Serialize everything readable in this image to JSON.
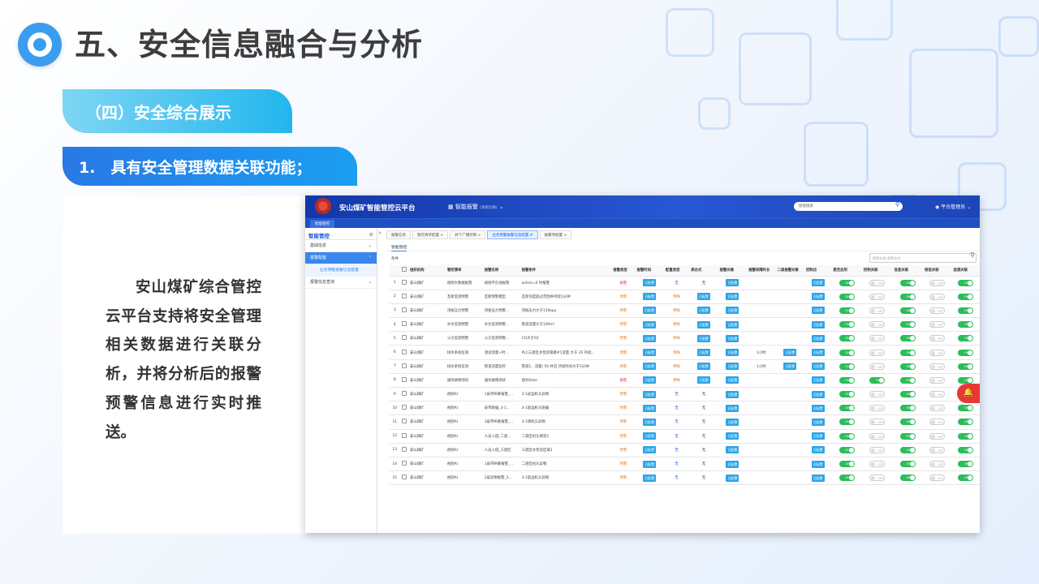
{
  "slide": {
    "title": "五、安全信息融合与分析",
    "section": "（四）安全综合展示",
    "subsection": "1.　具有安全管理数据关联功能；",
    "paragraph": "安山煤矿综合管控云平台支持将安全管理相关数据进行关联分析，并将分析后的报警预警信息进行实时推送。"
  },
  "app": {
    "name": "安山煤矿智能管控云平台",
    "module": "智能报警",
    "module_hint": "(系统切换)",
    "search_placeholder": "智能搜索",
    "user": "平台管理员",
    "subtab": "智能管控",
    "logo_caption": "安山煤矿"
  },
  "sidebar": {
    "head": "智能管控",
    "items": [
      {
        "label": "基础信息"
      },
      {
        "label": "报警配置"
      },
      {
        "label": "报警信息查询"
      }
    ],
    "sub_item": "业务预警报警信息配置"
  },
  "tabs": [
    "报警信息",
    "管控清单配置",
    "井下广播控制",
    "业务预警报警信息配置",
    "报警项配置"
  ],
  "content": {
    "breadcrumb": "智能管控",
    "filter_label": "条件",
    "search_placeholder": "报警名称,报警条件"
  },
  "table": {
    "headers": [
      "",
      "",
      "组织机构",
      "管控清单",
      "报警名称",
      "报警条件",
      "报警类型",
      "报警时间",
      "配置类型",
      "表达式",
      "报警对象",
      "报警间隔时长",
      "二级报警对象",
      "控制点",
      "是否启用",
      "控制关联",
      "信息关联",
      "短信关联",
      "监测关联"
    ],
    "btn_label": "日配置",
    "on_label": "ON",
    "off_label": "OFF",
    "rows": [
      {
        "no": "1",
        "org": "安山煤矿",
        "list": "视频大数据报警",
        "name": "视频不在线报警",
        "cond": "online=0 时报警",
        "type": "报警",
        "ptype": "无",
        "expr": "无",
        "interval": "",
        "second": false,
        "enabled": true,
        "ctrl": false,
        "info": true,
        "sms": false,
        "mon": true
      },
      {
        "no": "2",
        "org": "安山煤矿",
        "list": "瓦斯监测预警",
        "name": "瓦斯预警模型",
        "cond": "瓦斯浓度超过范围并持续1分钟",
        "type": "预警",
        "ptype": "特殊",
        "expr": "日配置",
        "interval": "",
        "second": false,
        "enabled": true,
        "ctrl": false,
        "info": true,
        "sms": false,
        "mon": true
      },
      {
        "no": "3",
        "org": "安山煤矿",
        "list": "顶板压力预警",
        "name": "顶板压力预警...",
        "cond": "顶板压力大于110kpa",
        "type": "预警",
        "ptype": "特殊",
        "expr": "日配置",
        "interval": "",
        "second": false,
        "enabled": true,
        "ctrl": false,
        "info": true,
        "sms": false,
        "mon": true
      },
      {
        "no": "4",
        "org": "安山煤矿",
        "list": "水文监测预警",
        "name": "水文监测预警...",
        "cond": "管道流量大于100m³",
        "type": "预警",
        "ptype": "特殊",
        "expr": "日配置",
        "interval": "",
        "second": false,
        "enabled": true,
        "ctrl": false,
        "info": true,
        "sms": false,
        "mon": true
      },
      {
        "no": "5",
        "org": "安山煤矿",
        "list": "火灾监测预警",
        "name": "火灾监测预警...",
        "cond": "CO大于50",
        "type": "预警",
        "ptype": "特殊",
        "expr": "日配置",
        "interval": "",
        "second": false,
        "enabled": true,
        "ctrl": false,
        "info": true,
        "sms": false,
        "mon": true
      },
      {
        "no": "6",
        "org": "安山煤矿",
        "list": "排水系统监测",
        "name": "测试流量+时...",
        "cond": "PLC三盘区水泵房管路#1流量 大于 35 持续...",
        "type": "预警",
        "ptype": "特殊",
        "expr": "日配置",
        "interval": "1小时",
        "second": true,
        "enabled": true,
        "ctrl": false,
        "info": true,
        "sms": false,
        "mon": true
      },
      {
        "no": "7",
        "org": "安山煤矿",
        "list": "排水系统监测",
        "name": "管道流量监控",
        "cond": "管道1、流量) 50 并且 持续时间大于5分钟",
        "type": "预警",
        "ptype": "特殊",
        "expr": "日配置",
        "interval": "1小时",
        "second": true,
        "enabled": true,
        "ctrl": false,
        "info": true,
        "sms": false,
        "mon": true
      },
      {
        "no": "8",
        "org": "安山煤矿",
        "list": "通风故障测试",
        "name": "通风故障测试",
        "cond": "值为false",
        "type": "报警",
        "ptype": "特殊",
        "expr": "日配置",
        "interval": "",
        "second": false,
        "enabled": true,
        "ctrl": true,
        "info": true,
        "sms": false,
        "mon": true
      },
      {
        "no": "9",
        "org": "安山煤矿",
        "list": "视频AI",
        "name": "1皮带纵撕报警_...",
        "cond": "3-1皮运机头异物",
        "type": "预警",
        "ptype": "无",
        "expr": "无",
        "interval": "",
        "second": false,
        "enabled": true,
        "ctrl": false,
        "info": true,
        "sms": false,
        "mon": true
      },
      {
        "no": "10",
        "org": "安山煤矿",
        "list": "视频AI",
        "name": "皮带跑偏_3-1...",
        "cond": "3-1胶运机头跑偏",
        "type": "预警",
        "ptype": "无",
        "expr": "无",
        "interval": "",
        "second": false,
        "enabled": true,
        "ctrl": false,
        "info": true,
        "sms": false,
        "mon": true
      },
      {
        "no": "11",
        "org": "安山煤矿",
        "list": "视频AI",
        "name": "3皮带纵撕报警_...",
        "cond": "3-1煤机头异物",
        "type": "预警",
        "ptype": "无",
        "expr": "无",
        "interval": "",
        "second": false,
        "enabled": true,
        "ctrl": false,
        "info": true,
        "sms": false,
        "mon": true
      },
      {
        "no": "12",
        "org": "安山煤矿",
        "list": "视频AI",
        "name": "人员入侵_二盘...",
        "cond": "二盘区机头硐室2",
        "type": "预警",
        "ptype": "无",
        "expr": "无",
        "interval": "",
        "second": false,
        "enabled": true,
        "ctrl": false,
        "info": true,
        "sms": false,
        "mon": true
      },
      {
        "no": "13",
        "org": "安山煤矿",
        "list": "视频AI",
        "name": "人员入侵_三盘区",
        "cond": "三盘区水泵房区域1",
        "type": "预警",
        "ptype": "无",
        "expr": "无",
        "interval": "",
        "second": false,
        "enabled": true,
        "ctrl": false,
        "info": true,
        "sms": false,
        "mon": true
      },
      {
        "no": "14",
        "org": "安山煤矿",
        "list": "视频AI",
        "name": "1皮带纵撕报警_...",
        "cond": "二盘区机头异物",
        "type": "预警",
        "ptype": "无",
        "expr": "无",
        "interval": "",
        "second": false,
        "enabled": true,
        "ctrl": false,
        "info": true,
        "sms": false,
        "mon": true
      },
      {
        "no": "15",
        "org": "安山煤矿",
        "list": "视频AI",
        "name": "2皮异物报警_3...",
        "cond": "3-1胶运机头异物",
        "type": "预警",
        "ptype": "无",
        "expr": "无",
        "interval": "",
        "second": false,
        "enabled": true,
        "ctrl": false,
        "info": true,
        "sms": false,
        "mon": true
      }
    ]
  },
  "colors": {
    "accent": "#2a78e6",
    "light_accent": "#22b6ee",
    "topbar": "#1237a8",
    "on": "#2bbd5a",
    "alert": "#e53935"
  },
  "icons": {
    "logo": "ring-logo-icon",
    "search": "magnifier-icon",
    "user": "user-icon",
    "bell": "bell-icon",
    "module": "grid-icon"
  }
}
